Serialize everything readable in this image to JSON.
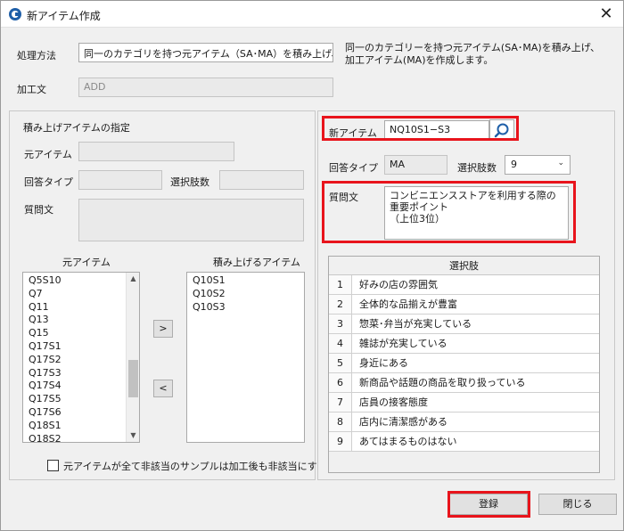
{
  "window": {
    "title": "新アイテム作成",
    "close_glyph": "✕",
    "icon": "app-logo-icon"
  },
  "top": {
    "method_label": "処理方法",
    "method_value": "同一のカテゴリを持つ元アイテム（SA･MA）を積み上げ、MAアイテ",
    "method_note_1": "同一のカテゴリーを持つ元アイテム(SA･MA)を積み上げ、",
    "method_note_2": "加工アイテム(MA)を作成します。",
    "expression_label": "加工文",
    "expression_value": "ADD"
  },
  "left": {
    "section_title": "積み上げアイテムの指定",
    "source_item_label": "元アイテム",
    "source_item_value": "",
    "answer_type_label": "回答タイプ",
    "answer_type_value": "",
    "choice_count_label": "選択肢数",
    "choice_count_value": "",
    "question_label": "質問文",
    "question_value": "",
    "source_list_header": "元アイテム",
    "stack_list_header": "積み上げるアイテム",
    "source_items": [
      "Q5S10",
      "Q7",
      "Q11",
      "Q13",
      "Q15",
      "Q17S1",
      "Q17S2",
      "Q17S3",
      "Q17S4",
      "Q17S5",
      "Q17S6",
      "Q18S1",
      "Q18S2"
    ],
    "stack_items": [
      "Q10S1",
      "Q10S2",
      "Q10S3"
    ],
    "add_button": ">",
    "remove_button": "<",
    "checkbox_label": "元アイテムが全て非該当のサンプルは加工後も非該当にする"
  },
  "right": {
    "new_item_label": "新アイテム",
    "new_item_value": "NQ10S1−S3",
    "answer_type_label": "回答タイプ",
    "answer_type_value": "MA",
    "choice_count_label": "選択肢数",
    "choice_count_value": "9",
    "question_label": "質問文",
    "question_value_1": "コンビニエンスストアを利用する際の重要ポイント",
    "question_value_2": "（上位3位）",
    "choices_header": "選択肢",
    "choices": [
      {
        "no": "1",
        "text": "好みの店の雰囲気"
      },
      {
        "no": "2",
        "text": "全体的な品揃えが豊富"
      },
      {
        "no": "3",
        "text": "惣菜･弁当が充実している"
      },
      {
        "no": "4",
        "text": "雑誌が充実している"
      },
      {
        "no": "5",
        "text": "身近にある"
      },
      {
        "no": "6",
        "text": "新商品や話題の商品を取り扱っている"
      },
      {
        "no": "7",
        "text": "店員の接客態度"
      },
      {
        "no": "8",
        "text": "店内に清潔感がある"
      },
      {
        "no": "9",
        "text": "あてはまるものはない"
      }
    ]
  },
  "footer": {
    "register_button": "登録",
    "close_button": "閉じる"
  },
  "colors": {
    "highlight": "#e8141c",
    "accent": "#1f5fa8"
  }
}
